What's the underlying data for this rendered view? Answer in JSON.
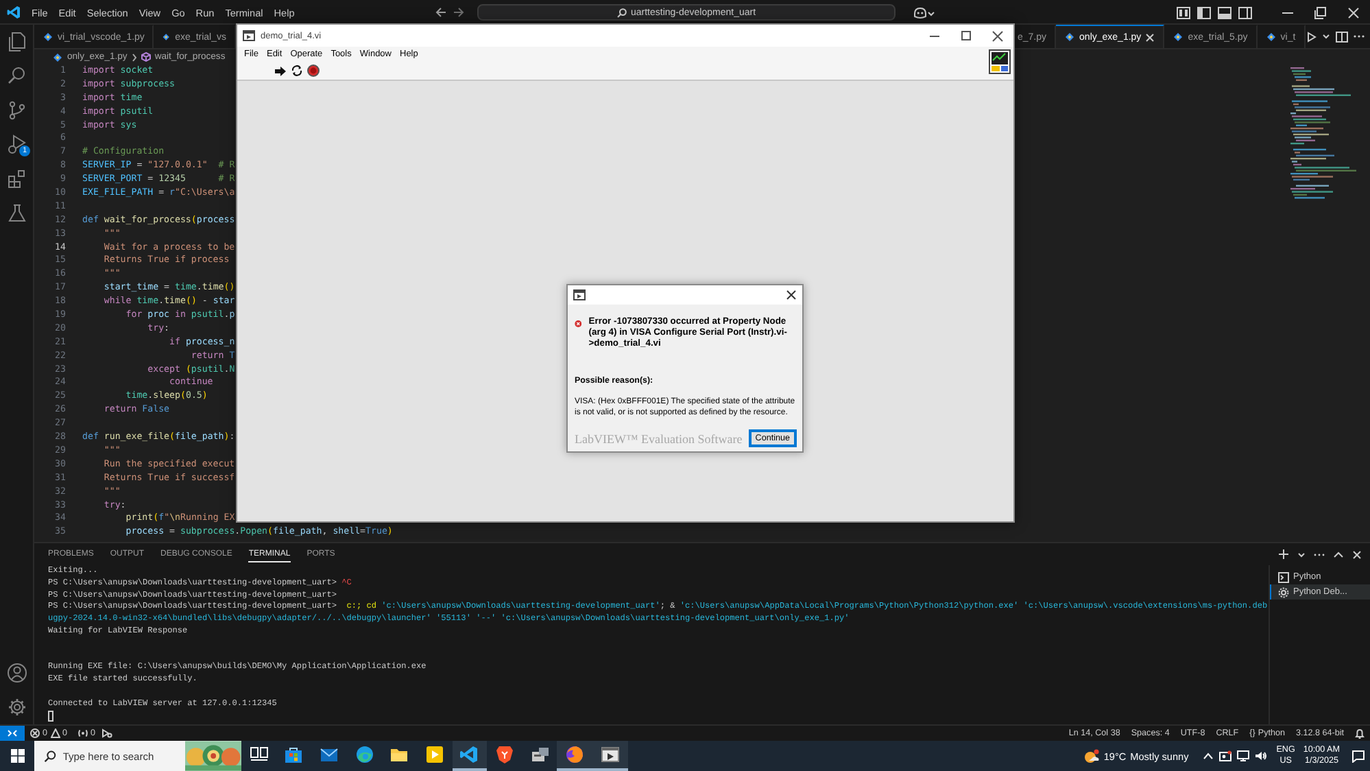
{
  "titlebar": {
    "menus": [
      "File",
      "Edit",
      "Selection",
      "View",
      "Go",
      "Run",
      "Terminal",
      "Help"
    ],
    "search": "uarttesting-development_uart"
  },
  "activity_bar": {
    "top": [
      {
        "kind": "explorer"
      },
      {
        "kind": "search"
      },
      {
        "kind": "source_control"
      },
      {
        "kind": "run_debug",
        "badge": "1"
      },
      {
        "kind": "extensions"
      },
      {
        "kind": "testing"
      }
    ],
    "bottom": [
      {
        "kind": "accounts"
      },
      {
        "kind": "manage"
      }
    ]
  },
  "editor": {
    "tabs_left": [
      {
        "label": "vi_trial_vscode_1.py",
        "selected": false
      },
      {
        "label": "exe_trial_vs",
        "selected": false
      }
    ],
    "tabs_right": [
      {
        "label": "e_7.py",
        "selected": false,
        "cut": true
      },
      {
        "label": "only_exe_1.py",
        "selected": true,
        "cut": false
      },
      {
        "label": "exe_trial_5.py",
        "selected": false,
        "cut": false
      },
      {
        "label": "vi_t",
        "selected": false,
        "cut": false
      }
    ],
    "breadcrumb": {
      "file": "only_exe_1.py",
      "symbol": "wait_for_process"
    },
    "lines": [
      {
        "number": "1",
        "current": false,
        "tokens": [
          {
            "kind": "keyword",
            "text": "import "
          },
          {
            "kind": "module",
            "text": "socket"
          }
        ]
      },
      {
        "number": "2",
        "current": false,
        "tokens": [
          {
            "kind": "keyword",
            "text": "import "
          },
          {
            "kind": "module",
            "text": "subprocess"
          }
        ]
      },
      {
        "number": "3",
        "current": false,
        "tokens": [
          {
            "kind": "keyword",
            "text": "import "
          },
          {
            "kind": "module",
            "text": "time"
          }
        ]
      },
      {
        "number": "4",
        "current": false,
        "tokens": [
          {
            "kind": "keyword",
            "text": "import "
          },
          {
            "kind": "module",
            "text": "psutil"
          }
        ]
      },
      {
        "number": "5",
        "current": false,
        "tokens": [
          {
            "kind": "keyword",
            "text": "import "
          },
          {
            "kind": "module",
            "text": "sys"
          }
        ]
      },
      {
        "number": "6",
        "current": false
      },
      {
        "number": "7",
        "current": false,
        "tokens": [
          {
            "kind": "comment",
            "text": "# Configuration"
          }
        ]
      },
      {
        "number": "8",
        "current": false,
        "tokens": [
          {
            "kind": "constant",
            "text": "SERVER_IP"
          },
          {
            "kind": "plain",
            "text": " = "
          },
          {
            "kind": "string",
            "text": "\"127.0.0.1\""
          },
          {
            "kind": "comment",
            "text": "  # R"
          }
        ]
      },
      {
        "number": "9",
        "current": false,
        "tokens": [
          {
            "kind": "constant",
            "text": "SERVER_PORT"
          },
          {
            "kind": "plain",
            "text": " = "
          },
          {
            "kind": "number",
            "text": "12345"
          },
          {
            "kind": "comment",
            "text": "      # R"
          }
        ]
      },
      {
        "number": "10",
        "current": false,
        "tokens": [
          {
            "kind": "constant",
            "text": "EXE_FILE_PATH"
          },
          {
            "kind": "plain",
            "text": " = "
          },
          {
            "kind": "storage",
            "text": "r"
          },
          {
            "kind": "string",
            "text": "\"C:\\Users\\a"
          }
        ]
      },
      {
        "number": "11",
        "current": false
      },
      {
        "number": "12",
        "current": false,
        "tokens": [
          {
            "kind": "storage",
            "text": "def "
          },
          {
            "kind": "function",
            "text": "wait_for_process"
          },
          {
            "kind": "bracket",
            "text": "("
          },
          {
            "kind": "variable",
            "text": "process"
          }
        ]
      },
      {
        "number": "13",
        "current": false,
        "tokens": [
          {
            "kind": "string",
            "text": "    \"\"\""
          }
        ]
      },
      {
        "number": "14",
        "current": true,
        "tokens": [
          {
            "kind": "string",
            "text": "    Wait for a process to be"
          }
        ]
      },
      {
        "number": "15",
        "current": false,
        "tokens": [
          {
            "kind": "string",
            "text": "    Returns True if process"
          }
        ]
      },
      {
        "number": "16",
        "current": false,
        "tokens": [
          {
            "kind": "string",
            "text": "    \"\"\""
          }
        ]
      },
      {
        "number": "17",
        "current": false,
        "tokens": [
          {
            "kind": "variable",
            "text": "    start_time"
          },
          {
            "kind": "plain",
            "text": " = "
          },
          {
            "kind": "module",
            "text": "time"
          },
          {
            "kind": "plain",
            "text": "."
          },
          {
            "kind": "function",
            "text": "time"
          },
          {
            "kind": "bracket",
            "text": "()"
          }
        ]
      },
      {
        "number": "18",
        "current": false,
        "tokens": [
          {
            "kind": "keyword",
            "text": "    while "
          },
          {
            "kind": "module",
            "text": "time"
          },
          {
            "kind": "plain",
            "text": "."
          },
          {
            "kind": "function",
            "text": "time"
          },
          {
            "kind": "bracket",
            "text": "()"
          },
          {
            "kind": "plain",
            "text": " - "
          },
          {
            "kind": "variable",
            "text": "star"
          }
        ]
      },
      {
        "number": "19",
        "current": false,
        "tokens": [
          {
            "kind": "keyword",
            "text": "        for "
          },
          {
            "kind": "variable",
            "text": "proc "
          },
          {
            "kind": "keyword",
            "text": "in "
          },
          {
            "kind": "module",
            "text": "psutil"
          },
          {
            "kind": "plain",
            "text": "."
          },
          {
            "kind": "variable",
            "text": "p"
          }
        ]
      },
      {
        "number": "20",
        "current": false,
        "tokens": [
          {
            "kind": "keyword",
            "text": "            try"
          },
          {
            "kind": "plain",
            "text": ":"
          }
        ]
      },
      {
        "number": "21",
        "current": false,
        "tokens": [
          {
            "kind": "keyword",
            "text": "                if "
          },
          {
            "kind": "variable",
            "text": "process_n"
          }
        ]
      },
      {
        "number": "22",
        "current": false,
        "tokens": [
          {
            "kind": "keyword",
            "text": "                    return "
          },
          {
            "kind": "storage",
            "text": "T"
          }
        ]
      },
      {
        "number": "23",
        "current": false,
        "tokens": [
          {
            "kind": "keyword",
            "text": "            except "
          },
          {
            "kind": "bracket",
            "text": "("
          },
          {
            "kind": "module",
            "text": "psutil"
          },
          {
            "kind": "plain",
            "text": "."
          },
          {
            "kind": "module",
            "text": "N"
          }
        ]
      },
      {
        "number": "24",
        "current": false,
        "tokens": [
          {
            "kind": "keyword",
            "text": "                continue"
          }
        ]
      },
      {
        "number": "25",
        "current": false,
        "tokens": [
          {
            "kind": "module",
            "text": "        time"
          },
          {
            "kind": "plain",
            "text": "."
          },
          {
            "kind": "function",
            "text": "sleep"
          },
          {
            "kind": "bracket",
            "text": "("
          },
          {
            "kind": "number",
            "text": "0.5"
          },
          {
            "kind": "bracket",
            "text": ")"
          }
        ]
      },
      {
        "number": "26",
        "current": false,
        "tokens": [
          {
            "kind": "keyword",
            "text": "    return "
          },
          {
            "kind": "storage",
            "text": "False"
          }
        ]
      },
      {
        "number": "27",
        "current": false
      },
      {
        "number": "28",
        "current": false,
        "tokens": [
          {
            "kind": "storage",
            "text": "def "
          },
          {
            "kind": "function",
            "text": "run_exe_file"
          },
          {
            "kind": "bracket",
            "text": "("
          },
          {
            "kind": "variable",
            "text": "file_path"
          },
          {
            "kind": "bracket",
            "text": ")"
          },
          {
            "kind": "plain",
            "text": ":"
          }
        ]
      },
      {
        "number": "29",
        "current": false,
        "tokens": [
          {
            "kind": "string",
            "text": "    \"\"\""
          }
        ]
      },
      {
        "number": "30",
        "current": false,
        "tokens": [
          {
            "kind": "string",
            "text": "    Run the specified execut"
          }
        ]
      },
      {
        "number": "31",
        "current": false,
        "tokens": [
          {
            "kind": "string",
            "text": "    Returns True if successf"
          }
        ]
      },
      {
        "number": "32",
        "current": false,
        "tokens": [
          {
            "kind": "string",
            "text": "    \"\"\""
          }
        ]
      },
      {
        "number": "33",
        "current": false,
        "tokens": [
          {
            "kind": "keyword",
            "text": "    try"
          },
          {
            "kind": "plain",
            "text": ":"
          }
        ]
      },
      {
        "number": "34",
        "current": false,
        "tokens": [
          {
            "kind": "function",
            "text": "        print"
          },
          {
            "kind": "bracket",
            "text": "("
          },
          {
            "kind": "storage",
            "text": "f"
          },
          {
            "kind": "string",
            "text": "\""
          },
          {
            "kind": "escape",
            "text": "\\n"
          },
          {
            "kind": "string",
            "text": "Running EX"
          }
        ]
      },
      {
        "number": "35",
        "current": false,
        "tokens": [
          {
            "kind": "variable",
            "text": "        process"
          },
          {
            "kind": "plain",
            "text": " = "
          },
          {
            "kind": "module",
            "text": "subprocess"
          },
          {
            "kind": "plain",
            "text": "."
          },
          {
            "kind": "module",
            "text": "Popen"
          },
          {
            "kind": "bracket",
            "text": "("
          },
          {
            "kind": "variable",
            "text": "file_path"
          },
          {
            "kind": "plain",
            "text": ", "
          },
          {
            "kind": "variable",
            "text": "shell"
          },
          {
            "kind": "plain",
            "text": "="
          },
          {
            "kind": "storage",
            "text": "True"
          },
          {
            "kind": "bracket",
            "text": ")"
          }
        ]
      }
    ]
  },
  "labview_window": {
    "title": "demo_trial_4.vi",
    "menus": [
      "File",
      "Edit",
      "Operate",
      "Tools",
      "Window",
      "Help"
    ],
    "dialog": {
      "message": "Error -1073807330 occurred at Property Node (arg 4) in VISA Configure Serial Port (Instr).vi->demo_trial_4.vi",
      "reason_heading": "Possible reason(s):",
      "reason": "VISA:  (Hex 0xBFFF001E) The specified state of the attribute is not valid, or is not supported as defined by the resource.",
      "watermark": "LabVIEW™ Evaluation Software",
      "button": "Continue"
    }
  },
  "panel": {
    "tabs": [
      {
        "label": "PROBLEMS",
        "selected": false
      },
      {
        "label": "OUTPUT",
        "selected": false
      },
      {
        "label": "DEBUG CONSOLE",
        "selected": false
      },
      {
        "label": "TERMINAL",
        "selected": true
      },
      {
        "label": "PORTS",
        "selected": false
      }
    ],
    "terminal_lines": [
      {
        "segments": [
          {
            "kind": "plain",
            "text": "Exiting..."
          }
        ]
      },
      {
        "segments": [
          {
            "kind": "plain",
            "text": "PS C:\\Users\\anupsw\\Downloads\\uarttesting-development_uart> "
          },
          {
            "kind": "red",
            "text": "^C"
          }
        ]
      },
      {
        "segments": [
          {
            "kind": "plain",
            "text": "PS C:\\Users\\anupsw\\Downloads\\uarttesting-development_uart>"
          }
        ]
      },
      {
        "segments": [
          {
            "kind": "plain",
            "text": "PS C:\\Users\\anupsw\\Downloads\\uarttesting-development_uart>  "
          },
          {
            "kind": "yellow",
            "text": "c:;"
          },
          {
            "kind": "yellow",
            "text": " cd"
          },
          {
            "kind": "cyan",
            "text": " 'c:\\Users\\anupsw\\Downloads\\uarttesting-development_uart'"
          },
          {
            "kind": "plain",
            "text": "; & "
          },
          {
            "kind": "cyan",
            "text": "'c:\\Users\\anupsw\\AppData\\Local\\Programs\\Python\\Python312\\python.exe'"
          },
          {
            "kind": "cyan",
            "text": " 'c:\\Users\\anupsw\\.vscode\\extensions\\ms-python.deb"
          }
        ]
      },
      {
        "segments": [
          {
            "kind": "cyan",
            "text": "ugpy-2024.14.0-win32-x64\\bundled\\libs\\debugpy\\adapter/../..\\debugpy\\launcher' '55113' '--' 'c:\\Users\\anupsw\\Downloads\\uarttesting-development_uart\\only_exe_1.py'"
          }
        ]
      },
      {
        "blank_after": true,
        "segments": [
          {
            "kind": "plain",
            "text": "Waiting for LabVIEW Response"
          }
        ]
      },
      {
        "blank_before": true,
        "segments": [
          {
            "kind": "plain",
            "text": "Running EXE file: C:\\Users\\anupsw\\builds\\DEMO\\My Application\\Application.exe"
          }
        ]
      },
      {
        "segments": [
          {
            "kind": "plain",
            "text": "EXE file started successfully."
          }
        ]
      },
      {
        "blank_before": true,
        "segments": [
          {
            "kind": "plain",
            "text": "Connected to LabVIEW server at 127.0.0.1:12345"
          }
        ]
      }
    ],
    "cursor": true,
    "terminals": [
      {
        "label": "Python",
        "kind": "shell",
        "selected": false
      },
      {
        "label": "Python Deb...",
        "kind": "debug",
        "selected": true
      }
    ]
  },
  "status_bar": {
    "errors": "0",
    "warnings": "0",
    "ports": "0",
    "items": [
      {
        "text": "Ln 14, Col 38"
      },
      {
        "text": "Spaces: 4"
      },
      {
        "text": "UTF-8"
      },
      {
        "text": "CRLF"
      },
      {
        "icon": "{}",
        "text": "Python"
      },
      {
        "text": "3.12.8 64-bit"
      }
    ]
  },
  "taskbar": {
    "search_placeholder": "Type here to search",
    "apps": [
      {
        "kind": "task_view",
        "active": false
      },
      {
        "kind": "store",
        "active": false
      },
      {
        "kind": "mail",
        "active": false
      },
      {
        "kind": "edge",
        "active": false
      },
      {
        "kind": "folder",
        "active": false
      },
      {
        "kind": "media",
        "active": false
      },
      {
        "kind": "code",
        "active": true
      },
      {
        "kind": "shield",
        "active": false
      },
      {
        "kind": "device",
        "active": false
      },
      {
        "kind": "fox",
        "active": true
      },
      {
        "kind": "labview",
        "active": true
      }
    ],
    "weather": {
      "temperature": "19°C",
      "condition": "Mostly sunny"
    },
    "language": {
      "top": "ENG",
      "bottom": "US"
    },
    "time": "10:00 AM",
    "date": "1/3/2025"
  }
}
